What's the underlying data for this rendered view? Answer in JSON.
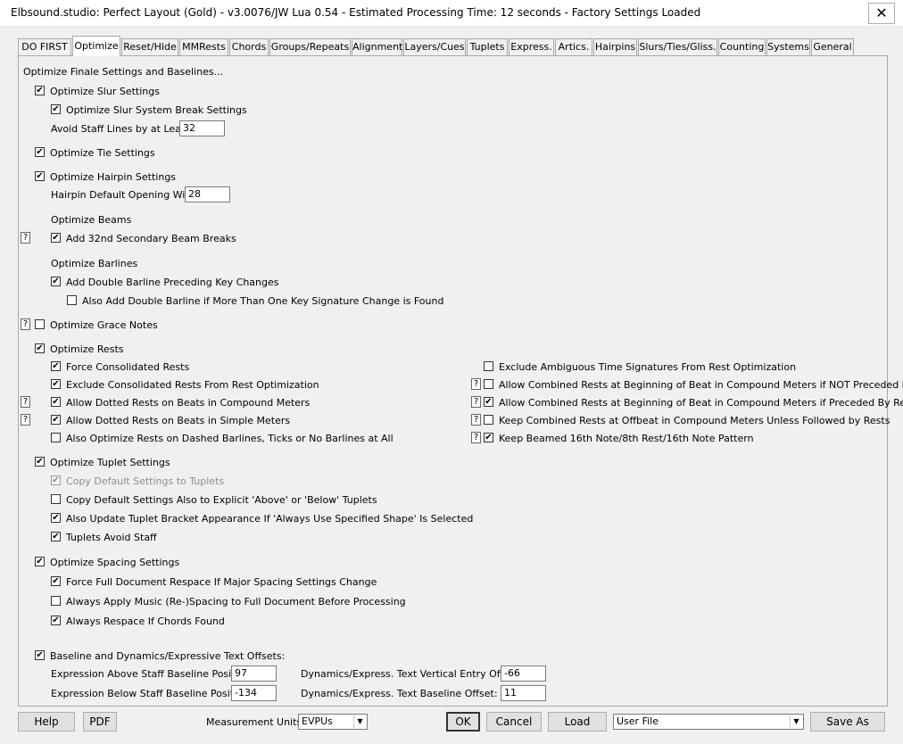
{
  "window": {
    "title": "Elbsound.studio: Perfect Layout (Gold) - v3.0076/JW Lua 0.54 - Estimated Processing Time: 12 seconds - Factory Settings Loaded",
    "close_label": "✕"
  },
  "tabs": [
    "DO FIRST",
    "Optimize",
    "Reset/Hide",
    "MMRests",
    "Chords",
    "Groups/Repeats",
    "Alignment",
    "Layers/Cues",
    "Tuplets",
    "Express.",
    "Artics.",
    "Hairpins",
    "Slurs/Ties/Gliss.",
    "Counting",
    "Systems",
    "General"
  ],
  "active_tab": "Optimize",
  "help_marker": "?",
  "panel": {
    "header": "Optimize Finale Settings and Baselines...",
    "slur": {
      "optimize": {
        "label": "Optimize Slur Settings",
        "checked": true
      },
      "system_break": {
        "label": "Optimize Slur System Break Settings",
        "checked": true
      },
      "avoid_label": "Avoid Staff Lines by at Least:",
      "avoid_value": "32"
    },
    "tie": {
      "label": "Optimize Tie Settings",
      "checked": true
    },
    "hairpin": {
      "optimize": {
        "label": "Optimize Hairpin Settings",
        "checked": true
      },
      "width_label": "Hairpin Default Opening Width:",
      "width_value": "28"
    },
    "beams": {
      "heading": "Optimize Beams",
      "secondary": {
        "label": "Add 32nd Secondary Beam Breaks",
        "checked": true
      }
    },
    "barlines": {
      "heading": "Optimize Barlines",
      "double": {
        "label": "Add Double Barline Preceding Key Changes",
        "checked": true
      },
      "also_double": {
        "label": "Also Add Double Barline if More Than One Key Signature Change is Found",
        "checked": false
      }
    },
    "grace": {
      "label": "Optimize Grace Notes",
      "checked": false
    },
    "rests": {
      "optimize": {
        "label": "Optimize Rests",
        "checked": true
      },
      "left": [
        {
          "label": "Force Consolidated Rests",
          "checked": true
        },
        {
          "label": "Exclude Consolidated Rests From Rest Optimization",
          "checked": true
        },
        {
          "label": "Allow Dotted Rests on Beats in Compound Meters",
          "checked": true
        },
        {
          "label": "Allow Dotted Rests on Beats in Simple Meters",
          "checked": true
        },
        {
          "label": "Also Optimize Rests on Dashed Barlines, Ticks or No Barlines at All",
          "checked": false
        }
      ],
      "right": [
        {
          "label": "Exclude Ambiguous Time Signatures From Rest Optimization",
          "checked": false
        },
        {
          "label": "Allow Combined Rests at Beginning of Beat in Compound Meters if NOT Preceded By Rests",
          "checked": false
        },
        {
          "label": "Allow Combined Rests at Beginning of Beat in Compound Meters if Preceded By Rests",
          "checked": true
        },
        {
          "label": "Keep Combined Rests at Offbeat in Compound Meters Unless Followed by Rests",
          "checked": false
        },
        {
          "label": "Keep Beamed 16th Note/8th Rest/16th Note Pattern",
          "checked": true
        }
      ]
    },
    "tuplet": {
      "optimize": {
        "label": "Optimize Tuplet Settings",
        "checked": true
      },
      "items": [
        {
          "label": "Copy Default Settings to Tuplets",
          "checked": true
        },
        {
          "label": "Copy Default Settings Also to Explicit 'Above' or 'Below' Tuplets",
          "checked": false
        },
        {
          "label": "Also Update Tuplet Bracket Appearance If 'Always Use Specified Shape' Is Selected",
          "checked": true
        },
        {
          "label": "Tuplets Avoid Staff",
          "checked": true
        }
      ]
    },
    "spacing": {
      "optimize": {
        "label": "Optimize Spacing Settings",
        "checked": true
      },
      "items": [
        {
          "label": "Force Full Document Respace If Major Spacing Settings Change",
          "checked": true
        },
        {
          "label": "Always Apply Music (Re-)Spacing to Full Document Before Processing",
          "checked": false
        },
        {
          "label": "Always Respace If Chords Found",
          "checked": true
        }
      ]
    },
    "baseline": {
      "optimize": {
        "label": "Baseline and Dynamics/Expressive Text Offsets:",
        "checked": true
      },
      "above_label": "Expression Above Staff Baseline Position:",
      "above_value": "97",
      "below_label": "Expression Below Staff Baseline Position:",
      "below_value": "-134",
      "vert_label": "Dynamics/Express. Text Vertical Entry Offset:",
      "vert_value": "-66",
      "base_label": "Dynamics/Express. Text Baseline Offset:",
      "base_value": "11"
    }
  },
  "footer": {
    "help": "Help",
    "pdf": "PDF",
    "units_label": "Measurement Units:",
    "units_value": "EVPUs",
    "ok": "OK",
    "cancel": "Cancel",
    "load": "Load",
    "file_value": "User File",
    "save_as": "Save As"
  }
}
